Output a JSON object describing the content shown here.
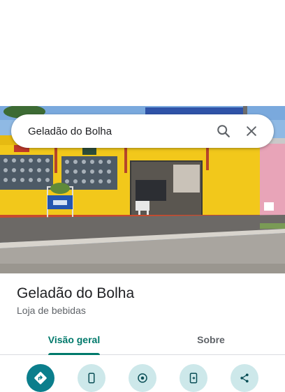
{
  "search": {
    "query": "Geladão do Bolha"
  },
  "place": {
    "name": "Geladão do Bolha",
    "category": "Loja de bebidas"
  },
  "tabs": [
    {
      "label": "Visão geral",
      "active": true
    },
    {
      "label": "Sobre",
      "active": false
    }
  ],
  "actions": [
    {
      "icon": "directions-icon"
    },
    {
      "icon": "phone-icon"
    },
    {
      "icon": "nearby-icon"
    },
    {
      "icon": "send-to-phone-icon"
    },
    {
      "icon": "share-icon"
    }
  ],
  "colors": {
    "accent": "#00796b",
    "action_primary": "#0b7e8c",
    "action_bg": "#cde8ea",
    "wall": "#f2c81b"
  }
}
